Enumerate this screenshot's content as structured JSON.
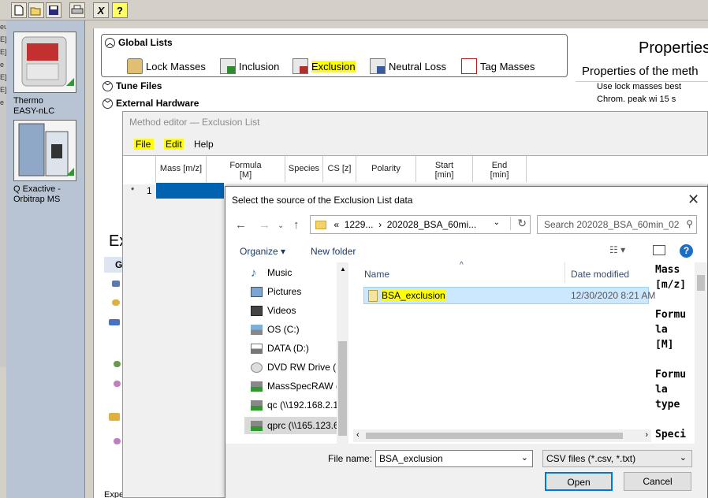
{
  "instruments": [
    {
      "name_line1": "Thermo",
      "name_line2": "EASY-nLC"
    },
    {
      "name_line1": "Q Exactive -",
      "name_line2": "Orbitrap MS"
    }
  ],
  "toolbar": {
    "icons": [
      "new-icon",
      "open-icon",
      "save-icon",
      "print-icon",
      "cut-icon",
      "help-icon"
    ],
    "help_glyph": "?",
    "cut_glyph": "X"
  },
  "global_lists": {
    "title": "Global Lists",
    "items": [
      "Lock Masses",
      "Inclusion",
      "Exclusion",
      "Neutral Loss",
      "Tag Masses"
    ],
    "highlighted": "Exclusion"
  },
  "sections": [
    "Tune Files",
    "External Hardware"
  ],
  "properties": {
    "title": "Properties",
    "subtitle": "Properties of the meth",
    "rows": [
      {
        "label": "Use lock masses",
        "value": "best"
      },
      {
        "label": "Chrom. peak wi",
        "value": "15 s"
      }
    ]
  },
  "background_text": {
    "ex_heading": "Ex",
    "g_label": "G",
    "bottom_text": "Expe"
  },
  "method_editor": {
    "title": "Method editor — Exclusion List",
    "menu": [
      "File",
      "Edit",
      "Help"
    ],
    "columns": [
      "Mass [m/z]",
      "Formula\n[M]",
      "Species",
      "CS [z]",
      "Polarity",
      "Start\n[min]",
      "End\n[min]"
    ],
    "row_marker": "*",
    "row_number": "1"
  },
  "dialog": {
    "title": "Select the source of the Exclusion List data",
    "address": [
      "«",
      "1229...",
      "›",
      "202028_BSA_60mi..."
    ],
    "search_placeholder": "Search 202028_BSA_60min_02",
    "organize": "Organize ▾",
    "new_folder": "New folder",
    "nav_items": [
      "Music",
      "Pictures",
      "Videos",
      "OS (C:)",
      "DATA (D:)",
      "DVD RW Drive (F",
      "MassSpecRAW (\\",
      "qc (\\\\192.168.2.1",
      "qprc (\\\\165.123.6"
    ],
    "columns": {
      "name": "Name",
      "date": "Date modified"
    },
    "files": [
      {
        "name": "BSA_exclusion",
        "date": "12/30/2020 8:21 AM"
      }
    ],
    "preview_lines": [
      "Mass",
      "[m/z]",
      "",
      "Formu",
      "la",
      "[M]",
      "",
      "Formu",
      "la",
      "type",
      "",
      "Speci"
    ],
    "file_name_label": "File name:",
    "file_name_value": "BSA_exclusion",
    "file_type": "CSV files (*.csv, *.txt)",
    "open_label": "Open",
    "cancel_label": "Cancel"
  },
  "colors": {
    "highlight": "#ffff00",
    "selection": "#cce8ff",
    "accent": "#0063b1"
  }
}
